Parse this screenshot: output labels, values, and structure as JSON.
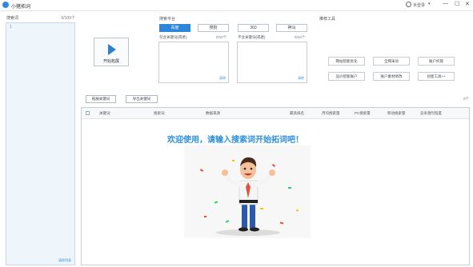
{
  "app": {
    "title": "小猪拓词",
    "user_status": "未登录",
    "window_min": "—",
    "window_max": "☐",
    "window_close": "✕",
    "dropdown_arrow": "▾"
  },
  "keywords": {
    "label": "搜索词",
    "count": "0/100个",
    "line_number": "1",
    "clear_label": "清除列表"
  },
  "start": {
    "label": "开始拓展"
  },
  "search_platform": {
    "title": "搜索平台",
    "tabs": [
      {
        "label": "百度",
        "active": true
      },
      {
        "label": "搜狗",
        "active": false
      },
      {
        "label": "360",
        "active": false
      },
      {
        "label": "神马",
        "active": false
      }
    ],
    "include": {
      "label": "包含关键词(或者)",
      "count": "0/10个",
      "clear": "清除"
    },
    "exclude": {
      "label": "不含关键词(或者)",
      "count": "0/10个",
      "clear": "清除"
    }
  },
  "tools": {
    "title": "推荐工具",
    "buttons": [
      "网站智能优化",
      "全网采词",
      "账户托管",
      "竞价智能账户",
      "账户素材修改",
      "创意工具++"
    ]
  },
  "results": {
    "tabs": [
      "拓展关键词",
      "导出关键词"
    ],
    "count": "0个",
    "columns": [
      "关键词",
      "搜索词",
      "数据来源",
      "最高排名",
      "月均搜索量",
      "PC搜索量",
      "移动搜索量",
      "竞争激烈程度"
    ]
  },
  "welcome": {
    "message": "欢迎使用，请输入搜索词开始拓词吧！"
  },
  "colors": {
    "accent": "#2d86d8",
    "welcome_text": "#2e8fd8"
  }
}
